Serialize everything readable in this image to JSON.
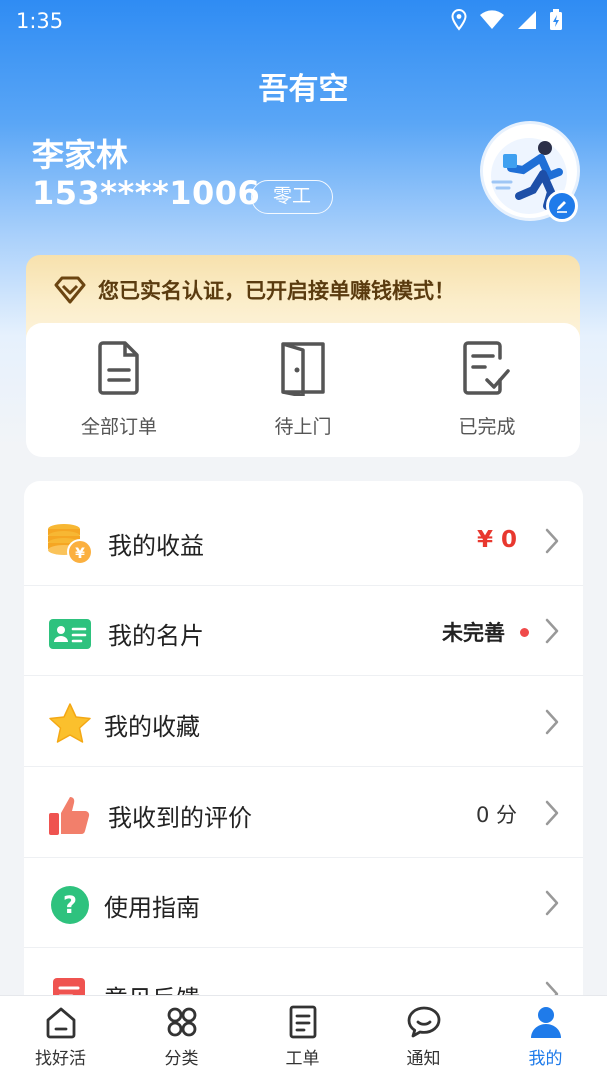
{
  "status_bar": {
    "time": "1:35"
  },
  "app": {
    "title": "吾有空"
  },
  "user": {
    "name": "李家林",
    "phone": "153****1006",
    "role": "零工"
  },
  "verify_banner": {
    "text": "您已实名认证，已开启接单赚钱模式！"
  },
  "orders": [
    {
      "label": "全部订单",
      "icon": "document-icon"
    },
    {
      "label": "待上门",
      "icon": "door-icon"
    },
    {
      "label": "已完成",
      "icon": "checklist-icon"
    }
  ],
  "menu": [
    {
      "label": "我的收益",
      "value": "¥ 0",
      "icon": "coins-icon"
    },
    {
      "label": "我的名片",
      "value": "未完善",
      "icon": "id-card-icon"
    },
    {
      "label": "我的收藏",
      "value": "",
      "icon": "star-icon"
    },
    {
      "label": "我收到的评价",
      "value": "0 分",
      "icon": "thumbs-up-icon"
    },
    {
      "label": "使用指南",
      "value": "",
      "icon": "help-icon"
    },
    {
      "label": "意见反馈",
      "value": "",
      "icon": "feedback-icon"
    }
  ],
  "tabs": [
    {
      "label": "找好活",
      "icon": "home-icon"
    },
    {
      "label": "分类",
      "icon": "grid-icon"
    },
    {
      "label": "工单",
      "icon": "worksheet-icon"
    },
    {
      "label": "通知",
      "icon": "chat-icon"
    },
    {
      "label": "我的",
      "icon": "person-icon",
      "active": true
    }
  ],
  "colors": {
    "primary": "#1f7bea",
    "accent_red": "#f04a4a",
    "banner_text": "#5a3b0f"
  }
}
